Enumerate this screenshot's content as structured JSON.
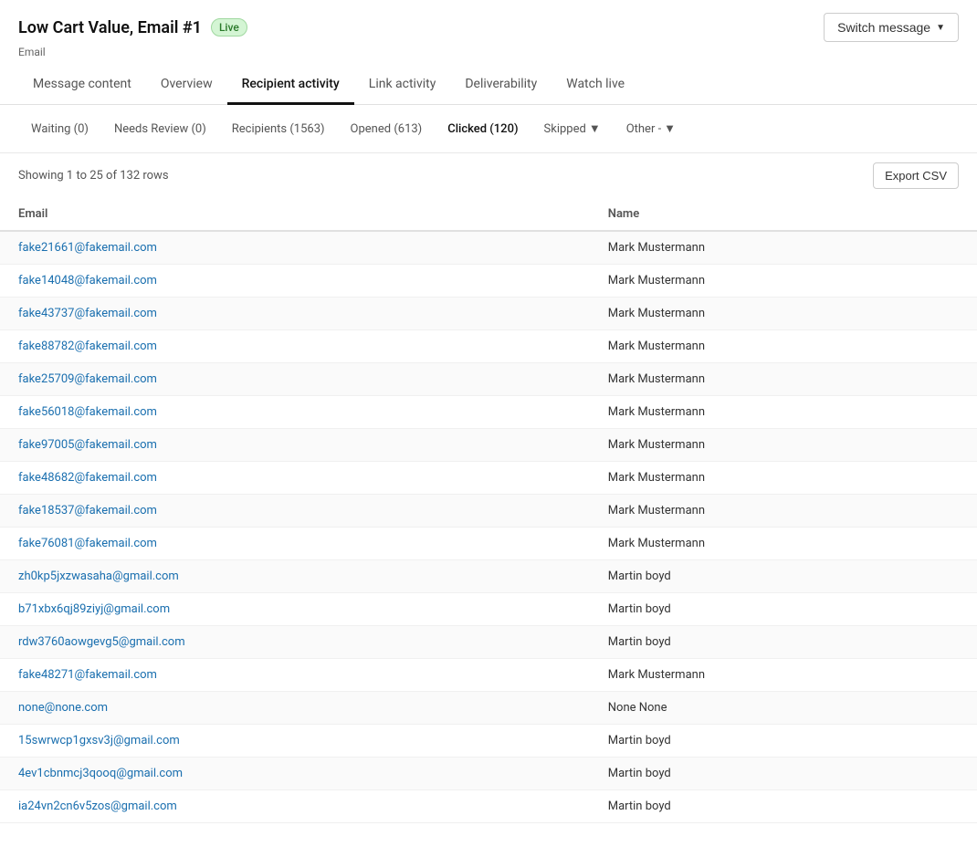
{
  "header": {
    "title": "Low Cart Value, Email #1",
    "badge": "Live",
    "subtitle": "Email",
    "switch_message_label": "Switch message"
  },
  "nav_tabs": [
    {
      "label": "Message content",
      "active": false
    },
    {
      "label": "Overview",
      "active": false
    },
    {
      "label": "Recipient activity",
      "active": true
    },
    {
      "label": "Link activity",
      "active": false
    },
    {
      "label": "Deliverability",
      "active": false
    },
    {
      "label": "Watch live",
      "active": false
    }
  ],
  "sub_tabs": [
    {
      "label": "Waiting (0)",
      "active": false,
      "has_arrow": false
    },
    {
      "label": "Needs Review (0)",
      "active": false,
      "has_arrow": false
    },
    {
      "label": "Recipients (1563)",
      "active": false,
      "has_arrow": false
    },
    {
      "label": "Opened (613)",
      "active": false,
      "has_arrow": false
    },
    {
      "label": "Clicked (120)",
      "active": true,
      "has_arrow": false
    },
    {
      "label": "Skipped",
      "active": false,
      "has_arrow": true
    },
    {
      "label": "Other",
      "active": false,
      "has_arrow": true
    }
  ],
  "table": {
    "showing_text": "Showing 1 to 25 of 132 rows",
    "export_label": "Export CSV",
    "columns": [
      "Email",
      "Name"
    ],
    "rows": [
      {
        "email": "fake21661@fakemail.com",
        "name": "Mark Mustermann"
      },
      {
        "email": "fake14048@fakemail.com",
        "name": "Mark Mustermann"
      },
      {
        "email": "fake43737@fakemail.com",
        "name": "Mark Mustermann"
      },
      {
        "email": "fake88782@fakemail.com",
        "name": "Mark Mustermann"
      },
      {
        "email": "fake25709@fakemail.com",
        "name": "Mark Mustermann"
      },
      {
        "email": "fake56018@fakemail.com",
        "name": "Mark Mustermann"
      },
      {
        "email": "fake97005@fakemail.com",
        "name": "Mark Mustermann"
      },
      {
        "email": "fake48682@fakemail.com",
        "name": "Mark Mustermann"
      },
      {
        "email": "fake18537@fakemail.com",
        "name": "Mark Mustermann"
      },
      {
        "email": "fake76081@fakemail.com",
        "name": "Mark Mustermann"
      },
      {
        "email": "zh0kp5jxzwasaha@gmail.com",
        "name": "Martin boyd"
      },
      {
        "email": "b71xbx6qj89ziyj@gmail.com",
        "name": "Martin boyd"
      },
      {
        "email": "rdw3760aowgevg5@gmail.com",
        "name": "Martin boyd"
      },
      {
        "email": "fake48271@fakemail.com",
        "name": "Mark Mustermann"
      },
      {
        "email": "none@none.com",
        "name": "None None"
      },
      {
        "email": "15swrwcp1gxsv3j@gmail.com",
        "name": "Martin boyd"
      },
      {
        "email": "4ev1cbnmcj3qooq@gmail.com",
        "name": "Martin boyd"
      },
      {
        "email": "ia24vn2cn6v5zos@gmail.com",
        "name": "Martin boyd"
      }
    ]
  }
}
